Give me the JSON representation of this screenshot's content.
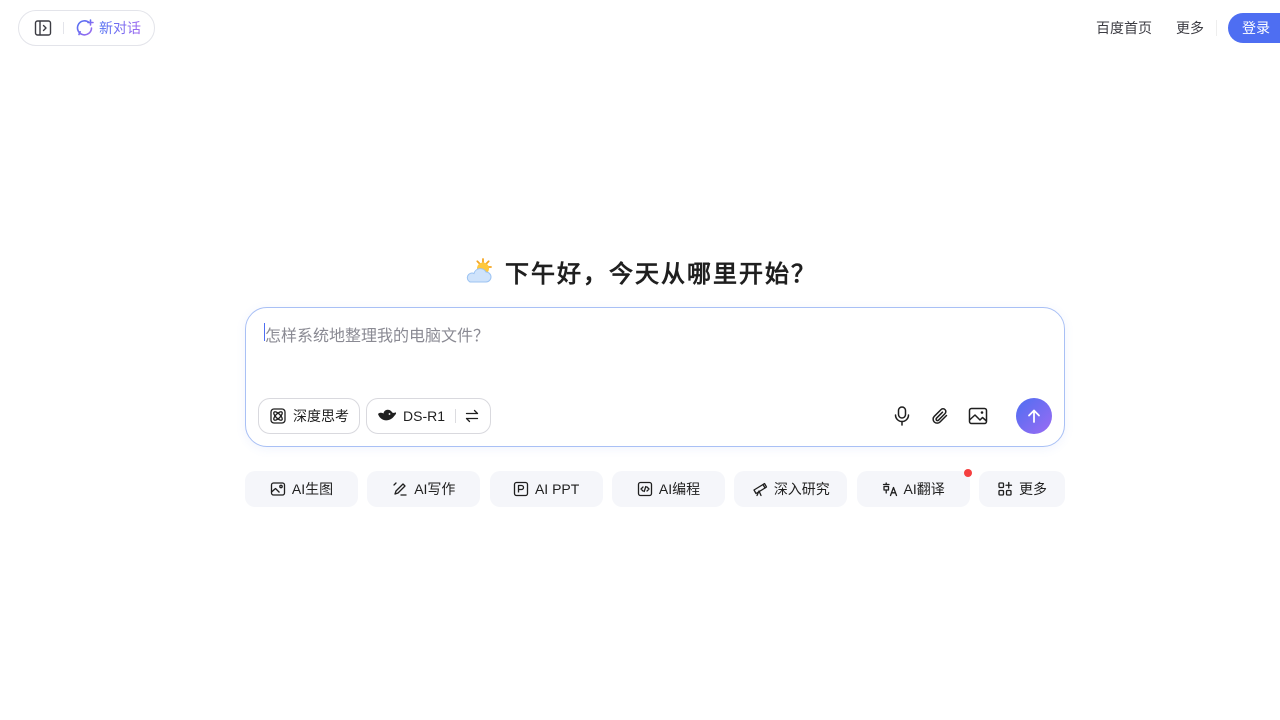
{
  "header": {
    "new_chat_label": "新对话",
    "links": [
      "百度首页",
      "更多"
    ],
    "login_label": "登录"
  },
  "greeting": {
    "text": "下午好，今天从哪里开始？",
    "emoji_icon": "sun-behind-cloud-icon"
  },
  "input": {
    "placeholder": "怎样系统地整理我的电脑文件？",
    "deep_think_label": "深度思考",
    "model_label": "DS-R1"
  },
  "features": [
    {
      "label": "AI生图",
      "icon": "image-gen-icon"
    },
    {
      "label": "AI写作",
      "icon": "pen-icon"
    },
    {
      "label": "AI PPT",
      "icon": "ppt-icon"
    },
    {
      "label": "AI编程",
      "icon": "code-icon"
    },
    {
      "label": "深入研究",
      "icon": "telescope-icon"
    },
    {
      "label": "AI翻译",
      "icon": "translate-icon",
      "badge": true
    },
    {
      "label": "更多",
      "icon": "apps-icon"
    }
  ],
  "colors": {
    "accent": "#4e6ef2",
    "accent_gradient_end": "#9b6cf3",
    "badge": "#f53f3f",
    "chip_bg": "#f5f6fa"
  }
}
